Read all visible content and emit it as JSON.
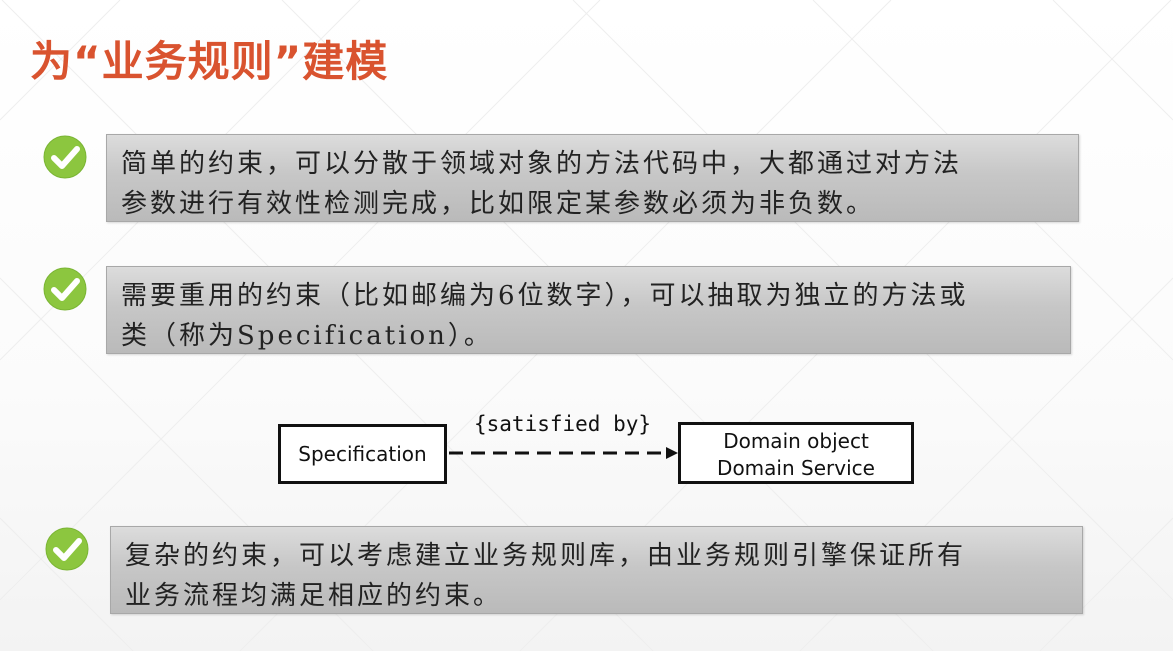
{
  "slide": {
    "title": "为“业务规则”建模",
    "title_color": "#d9532f",
    "check_color": "#8cc63f",
    "bullets": [
      {
        "icon": "check-circle-icon",
        "lines": [
          "简单的约束，可以分散于领域对象的方法代码中，大都通过对方法",
          "参数进行有效性检测完成，比如限定某参数必须为非负数。"
        ]
      },
      {
        "icon": "check-circle-icon",
        "lines": [
          "需要重用的约束（比如邮编为6位数字），可以抽取为独立的方法或",
          "类（称为Specification）。"
        ]
      },
      {
        "icon": "check-circle-icon",
        "lines": [
          "复杂的约束，可以考虑建立业务规则库，由业务规则引擎保证所有",
          "业务流程均满足相应的约束。"
        ]
      }
    ],
    "diagram": {
      "source_label": "Specification",
      "relation_label": "{satisfied by}",
      "target_lines": [
        "Domain object",
        "Domain Service"
      ]
    }
  }
}
